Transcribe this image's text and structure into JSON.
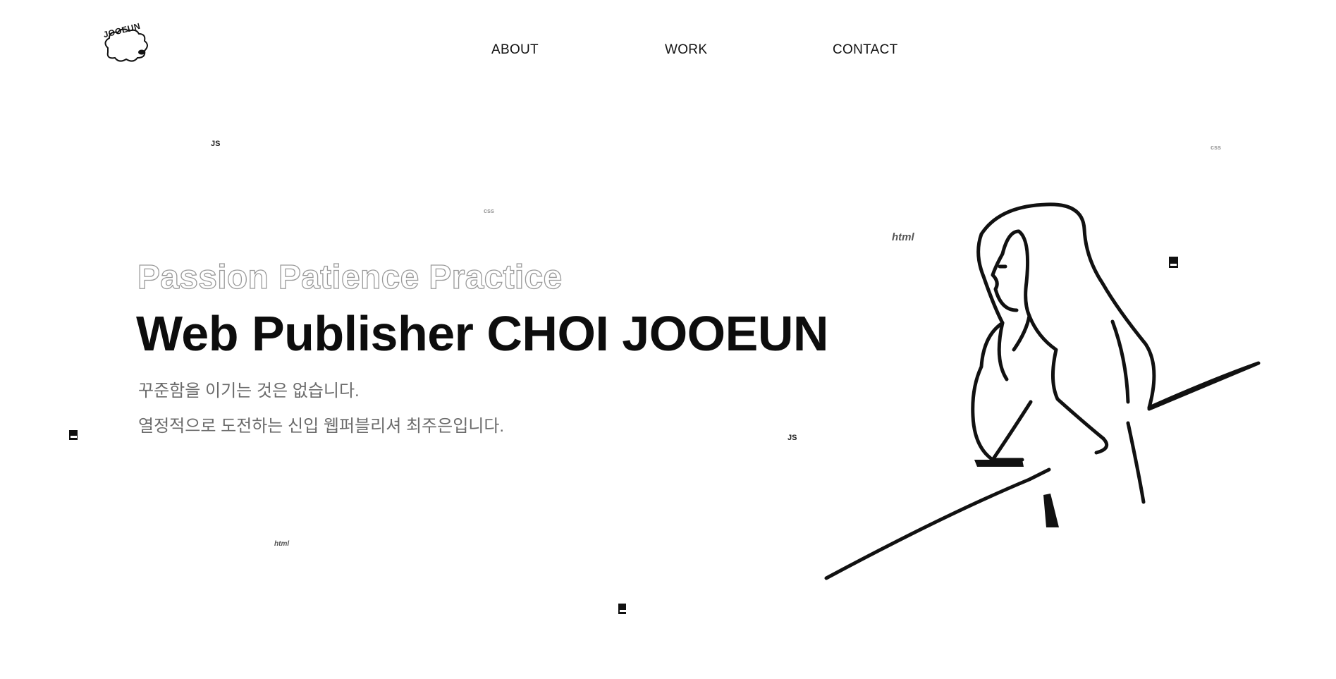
{
  "logo": {
    "text": "JOOEUN"
  },
  "nav": {
    "items": [
      "ABOUT",
      "WORK",
      "CONTACT"
    ]
  },
  "hero": {
    "tagline": "Passion Patience Practice",
    "headline": "Web Publisher CHOI JOOEUN",
    "intro_line1": "꾸준함을 이기는 것은 없습니다.",
    "intro_line2": "열정적으로 도전하는 신입 웹퍼블리셔 최주은입니다."
  },
  "floating": {
    "js": "JS",
    "css": "css",
    "html": "html"
  },
  "icons": {
    "file": "file-icon",
    "illustration": "girl-line-illustration"
  }
}
